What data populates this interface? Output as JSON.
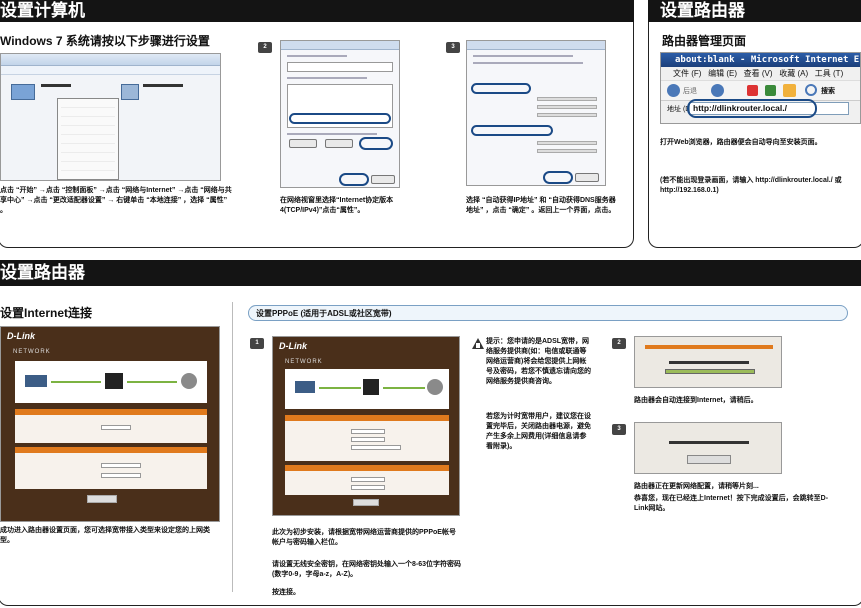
{
  "left_top": {
    "banner_title": "设置计算机",
    "subtitle": "Windows 7 系统请按以下步骤进行设置",
    "step1_caption": "点击 “开始” →点击 “控制面板” →点击 “网络与Internet” →点击 “网络与共享中心” →点击 “更改适配器设置” → 右键单击 “本地连接” ，选择 “属性” 。",
    "step2_badge": "2",
    "step2_caption": "在网络视窗里选择“Internet协定版本4(TCP/IPv4)”点击“属性”。",
    "step3_badge": "3",
    "step3_caption": "选择 “自动获得IP地址” 和 “自动获得DNS服务器地址” ，点击 “确定” 。返回上一个界面，点击。"
  },
  "right_top": {
    "banner_title": "设置路由器",
    "subtitle": "路由器管理页面",
    "browser_title": "about:blank - Microsoft Internet E",
    "menu": [
      "文件 (F)",
      "编辑 (E)",
      "查看 (V)",
      "收藏 (A)",
      "工具 (T)"
    ],
    "back_label": "后退",
    "search_label": "搜索",
    "address_label": "地址 (D)",
    "address_value": "http://dlinkrouter.local./",
    "info": "打开Web浏览器，路由器便会自动导向至安装页面。",
    "note": "(若不能出现登录画面，请输入 http://dlinkrouter.local./ 或 http://192.168.0.1)"
  },
  "bottom": {
    "banner_title": "设置路由器",
    "internet_subtitle": "设置Internet连接",
    "internet_caption": "成功进入路由器设置页面，您可选择宽带接入类型来设定您的上网类型。",
    "pppoe_title": "设置PPPoE (适用于ADSL或社区宽带)",
    "step1_badge": "1",
    "step1_caption_a": "此次为初步安装，请根据宽带网络运营商提供的PPPoE帐号帐户与密码输入栏位。",
    "step1_caption_b": "请设置无线安全密钥，在网络密钥处输入一个8-63位字符密码(数字0-9，字母a-z，A-Z)。",
    "step1_caption_c": "按连接。",
    "tip": "提示：您申请的是ADSL宽带，网络服务提供商(如：电信或联通等网络运营商)将会给您提供上网帐号及密码，若您不慎遗忘请向您的网络服务提供商咨询。",
    "tip2": "若您为计时宽带用户，建议您在设置完毕后，关闭路由器电源，避免产生多余上网费用(详细信息请参看附录)。",
    "step2_badge": "2",
    "step2_caption": "路由器会自动连接到Internet，请稍后。",
    "step3_badge": "3",
    "step3_caption_a": "路由器正在更新网络配置，请稍等片刻...",
    "step3_caption_b": "恭喜您，现在已经连上Internet！按下完成设置后，会跳转至D-Link网站。",
    "router_logo": "D-Link",
    "router_model": "NETWORK"
  },
  "colors": {
    "banner": "#141414",
    "accent_blue": "#1b4a86",
    "dlink_orange": "#e07a1d"
  }
}
